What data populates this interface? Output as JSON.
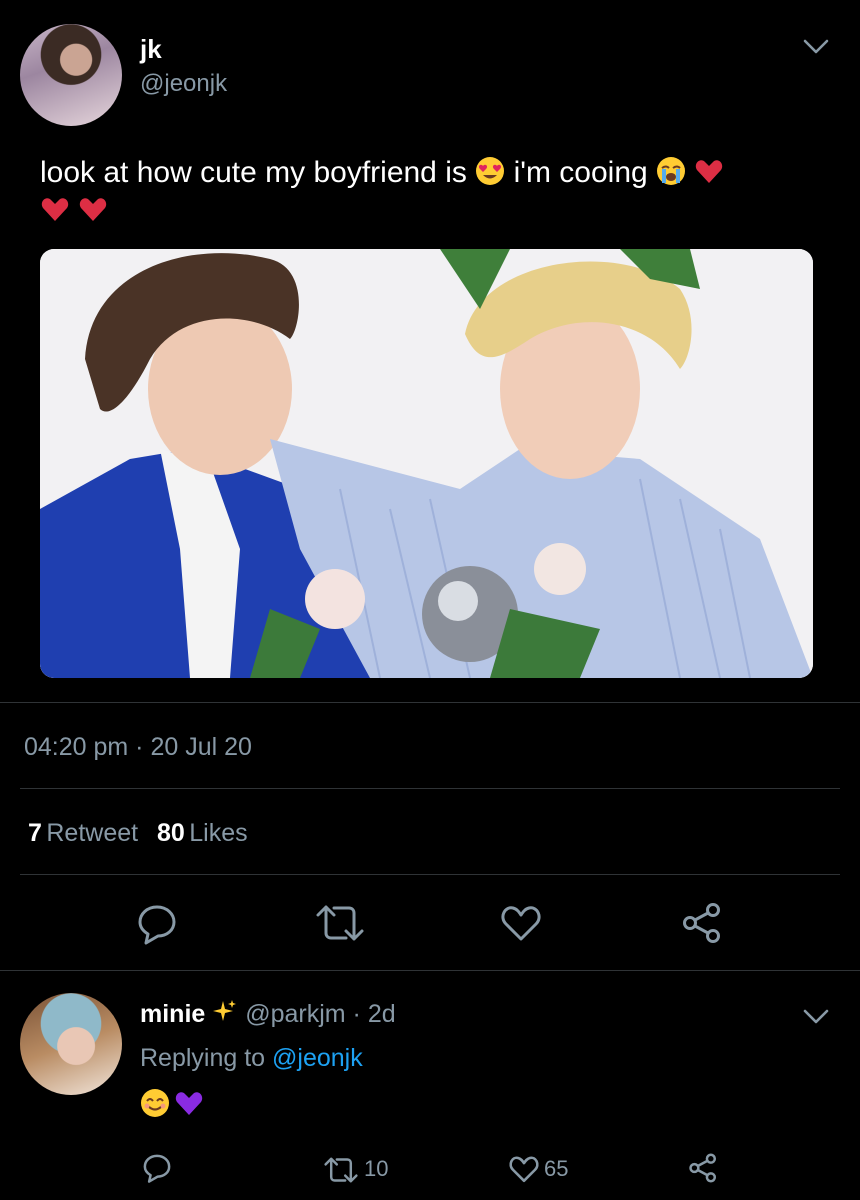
{
  "tweet": {
    "author_name": "jk",
    "author_handle": "@jeonjk",
    "text_part1": "look at how cute my boyfriend is",
    "text_part2": "i'm cooing",
    "timestamp": "04:20 pm · 20 Jul 20",
    "retweet_count": "7",
    "retweet_label": "Retweet",
    "like_count": "80",
    "like_label": "Likes"
  },
  "reply": {
    "author_name": "minie",
    "author_handle": "@parkjm",
    "age": "· 2d",
    "replying_prefix": "Replying to",
    "replying_to": "@jeonjk",
    "retweet_count": "10",
    "like_count": "65"
  },
  "icons": {
    "avatar_jk": "avatar",
    "avatar_minie": "avatar",
    "more": "chevron-down-icon",
    "reply": "comment-icon",
    "retweet": "retweet-icon",
    "like": "heart-icon",
    "share": "share-icon"
  },
  "colors": {
    "background": "#000000",
    "muted": "#8899a6",
    "link": "#1da1f2",
    "divider": "#2f3336"
  }
}
